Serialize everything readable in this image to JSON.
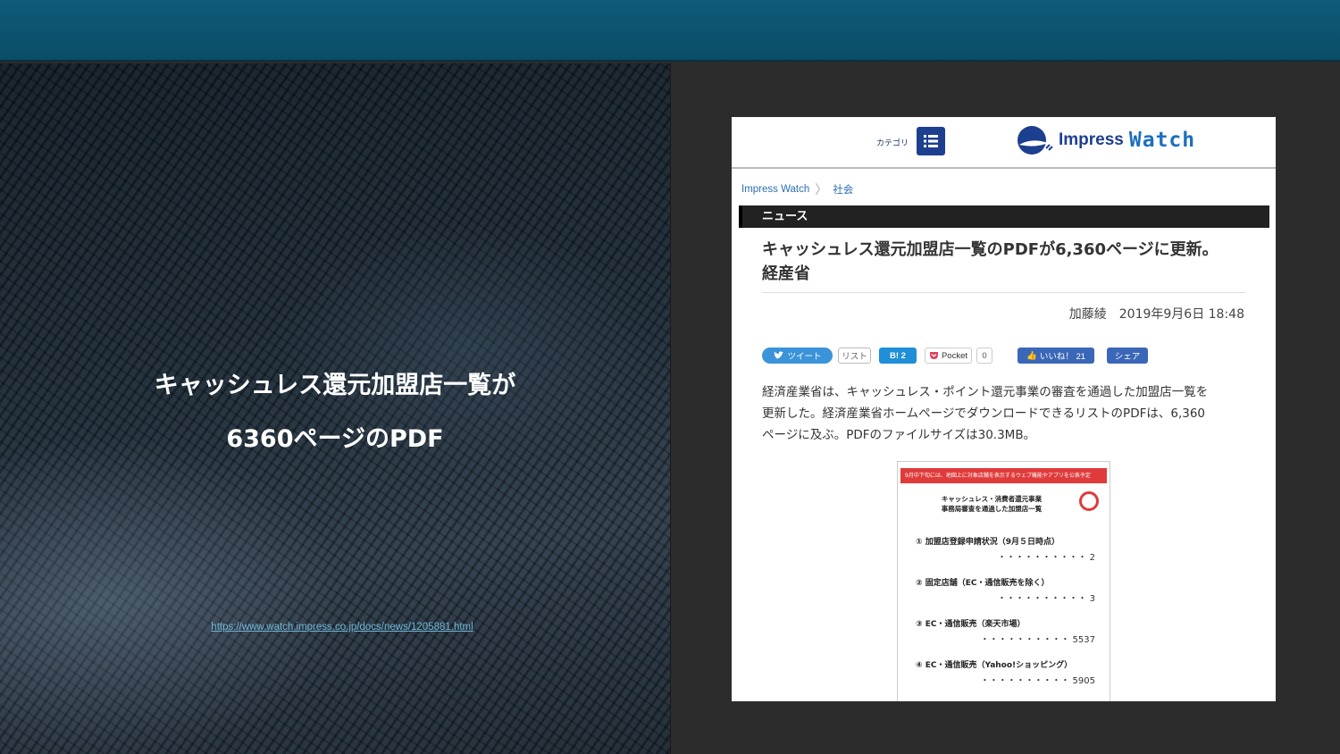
{
  "slide": {
    "title_line1": "キャッシュレス還元加盟店一覧が",
    "title_line2": "6360ページのPDF",
    "source_url": "https://www.watch.impress.co.jp/docs/news/1205881.html"
  },
  "article": {
    "category_label": "カテゴリ",
    "logo_impress": "Impress",
    "logo_watch": "Watch",
    "breadcrumb": [
      "Impress Watch",
      "社会"
    ],
    "section": "ニュース",
    "headline_line1": "キャッシュレス還元加盟店一覧のPDFが6,360ページに更新。",
    "headline_line2": "経産省",
    "author": "加藤綾",
    "datetime": "2019年9月6日 18:48",
    "social": {
      "tweet": "ツイート",
      "list": "リスト",
      "hatena": "B! 2",
      "pocket": "Pocket",
      "pocket_count": "0",
      "fb_like": "いいね！ 21",
      "fb_share": "シェア"
    },
    "body_lines": [
      "経済産業省は、キャッシュレス・ポイント還元事業の審査を通過した加盟店一覧を",
      "更新した。経済産業省ホームページでダウンロードできるリストのPDFは、6,360",
      "ページに及ぶ。PDFのファイルサイズは30.3MB。"
    ],
    "doc": {
      "banner": "9月中下旬には、地図上に対象店舗を表示するウェブ機能やアプリを公表予定",
      "title_line1": "キャッシュレス・消費者還元事業",
      "title_line2": "事務局審査を通過した加盟店一覧",
      "items": [
        {
          "label": "① 加盟店登録申請状況（9月５日時点）",
          "value": "・・・・・・・・・・ 2"
        },
        {
          "label": "② 固定店舗（EC・通信販売を除く）",
          "value": "・・・・・・・・・・ 3"
        },
        {
          "label": "③ EC・通信販売（楽天市場）",
          "value": "・・・・・・・・・・ 5537"
        },
        {
          "label": "④ EC・通信販売（Yahoo!ショッピング）",
          "value": "・・・・・・・・・・ 5905"
        }
      ]
    }
  }
}
